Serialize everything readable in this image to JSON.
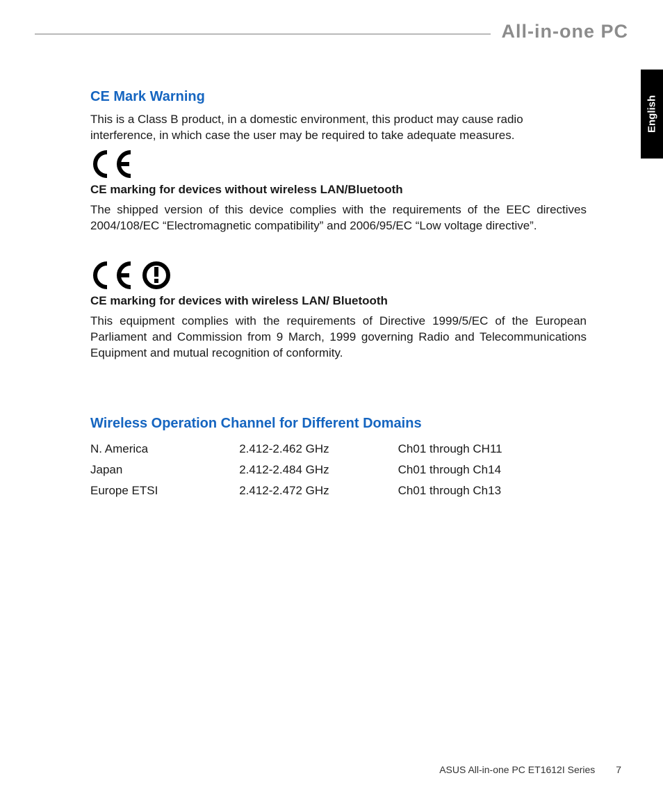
{
  "header": {
    "product_line": "All-in-one PC"
  },
  "language_tab": "English",
  "sections": {
    "ce_mark": {
      "heading": "CE Mark Warning",
      "intro": "This is a Class B product, in a domestic environment, this product may cause radio interference, in which case the user may be required to take adequate measures.",
      "sub1_heading": "CE marking for devices without wireless LAN/Bluetooth",
      "sub1_body": "The shipped version of this device complies with the requirements of the EEC directives 2004/108/EC “Electromagnetic compatibility” and 2006/95/EC “Low voltage directive”.",
      "sub2_heading": "CE marking for devices with wireless LAN/ Bluetooth",
      "sub2_body": "This equipment complies with the requirements of Directive 1999/5/EC of the European Parliament and Commission from 9 March, 1999 governing Radio and Telecommunications Equipment and mutual recognition of conformity."
    },
    "wireless": {
      "heading": "Wireless Operation Channel for Different Domains",
      "rows": [
        {
          "region": "N. America",
          "freq": "2.412-2.462 GHz",
          "ch": "Ch01 through CH11"
        },
        {
          "region": "Japan",
          "freq": "2.412-2.484 GHz",
          "ch": "Ch01 through Ch14"
        },
        {
          "region": "Europe ETSI",
          "freq": "2.412-2.472 GHz",
          "ch": "Ch01 through Ch13"
        }
      ]
    }
  },
  "footer": {
    "text": "ASUS All-in-one PC  ET1612I Series",
    "page_number": "7"
  }
}
